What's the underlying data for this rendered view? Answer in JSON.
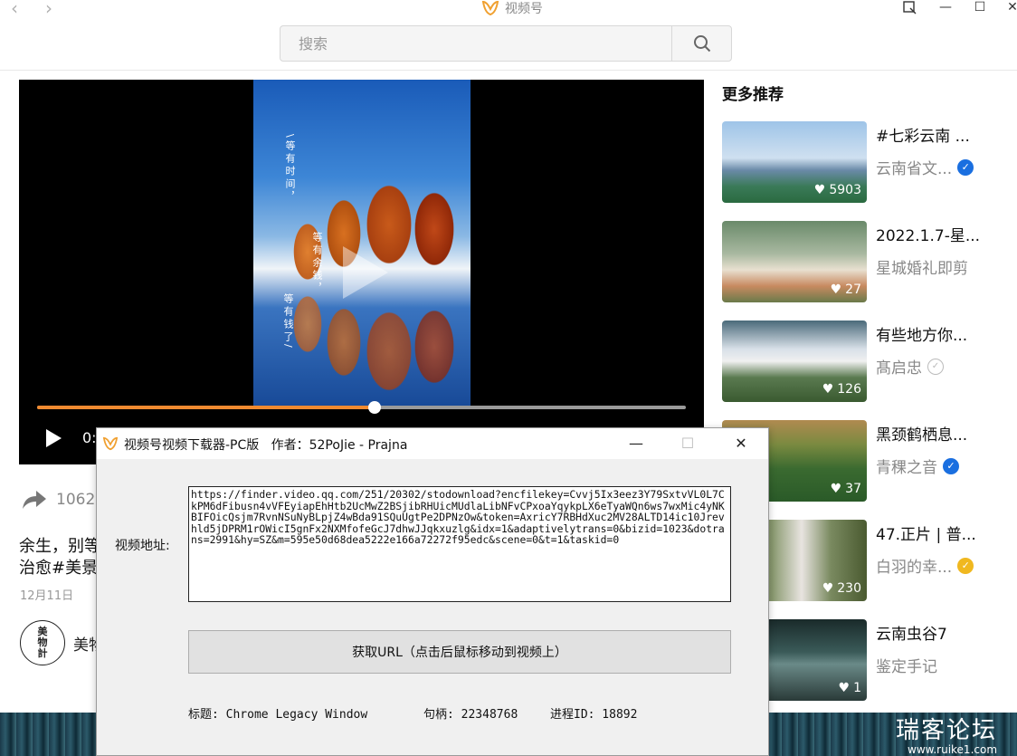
{
  "app": {
    "title": "视频号",
    "search_placeholder": "搜索",
    "accent": "#f08a30"
  },
  "player": {
    "frame_text_1": "\\等有时间，",
    "frame_text_2": "等有余钱，",
    "frame_text_3": "等有钱了/",
    "time": "0:",
    "progress": 0.52
  },
  "post": {
    "share_count": "1062",
    "caption_line1": "余生，别等",
    "caption_line2": "治愈#美景",
    "date": "12月11日",
    "author_avatar_text": "美物計",
    "author_name": "美物"
  },
  "recommendations": {
    "title": "更多推荐",
    "items": [
      {
        "title": "#七彩云南 ...",
        "author": "云南省文...",
        "likes": "5903",
        "verified": "blue"
      },
      {
        "title": "2022.1.7-星...",
        "author": "星城婚礼即剪",
        "likes": "27",
        "verified": "none"
      },
      {
        "title": "有些地方你...",
        "author": "髙启忠",
        "likes": "126",
        "verified": "gray"
      },
      {
        "title": "黑颈鹤栖息...",
        "author": "青稞之音",
        "likes": "37",
        "verified": "blue"
      },
      {
        "title": "47.正片 | 普...",
        "author": "白羽的幸...",
        "likes": "230",
        "verified": "gold"
      },
      {
        "title": "云南虫谷7",
        "author": "鉴定手记",
        "likes": "1",
        "verified": "none"
      }
    ]
  },
  "dialog": {
    "title": "视频号视频下载器-PC版   作者：52PoJie - Prajna",
    "url_label": "视频地址:",
    "url_value": "https://finder.video.qq.com/251/20302/stodownload?encfilekey=Cvvj5Ix3eez3Y79SxtvVL0L7CkPM6dFibusn4vVFEyiapEhHtb2UcMwZ2BSjibRHUicMUdlaLibNFvCPxoaYqykpLX6eTyaWQn6ws7wxMic4yNKBIFOicQsjm7RvnNSuNyBLpjZ4wBda91SQuUgtPe2DPNzOw&token=AxricY7RBHdXuc2MV28ALTD14ic10Jrevhld5jDPRM1rOWicI5gnFx2NXMfofeGcJ7dhwJJqkxuzlg&idx=1&adaptivelytrans=0&bizid=1023&dotrans=2991&hy=SZ&m=595e50d68dea5222e166a72272f95edc&scene=0&t=1&taskid=0",
    "button_label": "获取URL（点击后鼠标移动到视频上）",
    "title_info": "标题: Chrome Legacy Window",
    "handle_info": "句柄: 22348768",
    "pid_info": "进程ID: 18892"
  },
  "watermark": {
    "main": "瑞客论坛",
    "url": "www.ruike1.com"
  }
}
